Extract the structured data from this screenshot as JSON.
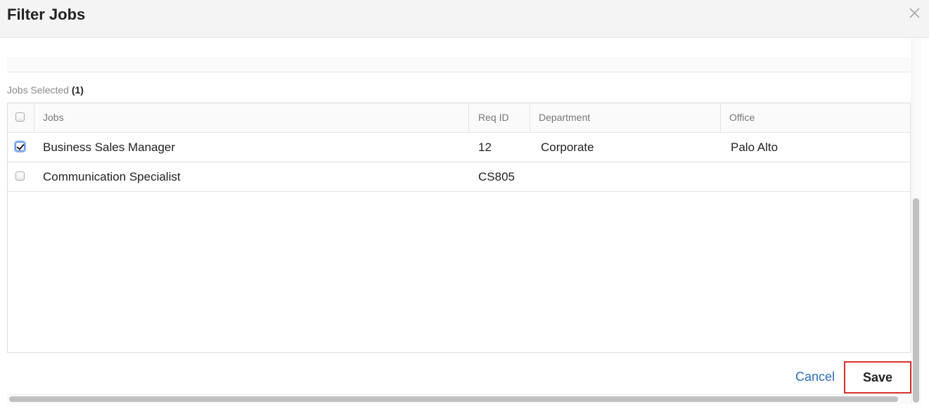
{
  "dialog": {
    "title": "Filter Jobs",
    "close_icon": "close-icon"
  },
  "selection": {
    "label": "Jobs Selected",
    "count": "(1)"
  },
  "table": {
    "columns": [
      "Jobs",
      "Req ID",
      "Department",
      "Office"
    ],
    "rows": [
      {
        "checked": true,
        "job": "Business Sales Manager",
        "req_id": "12",
        "department": "Corporate",
        "office": "Palo Alto"
      },
      {
        "checked": false,
        "job": "Communication Specialist",
        "req_id": "CS805",
        "department": "",
        "office": ""
      }
    ]
  },
  "footer": {
    "cancel_label": "Cancel",
    "save_label": "Save"
  },
  "colors": {
    "link": "#2a6ebb",
    "highlight_border": "#d9302c",
    "header_bg": "#f4f4f4"
  }
}
